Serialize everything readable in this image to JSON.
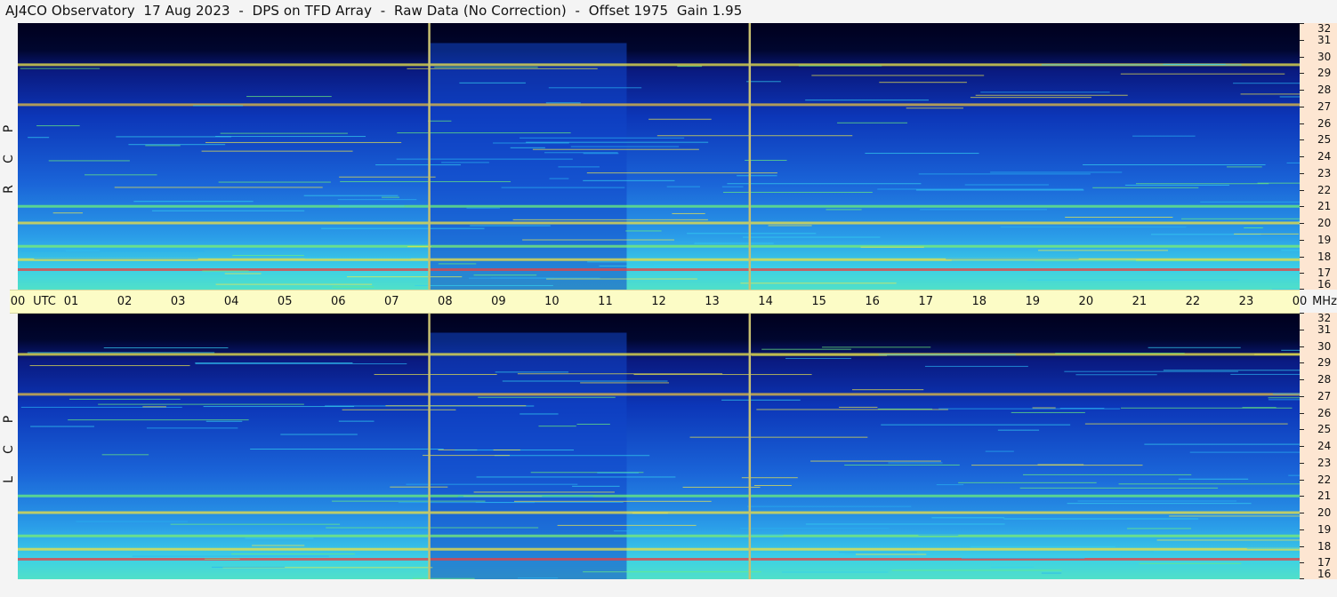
{
  "title": "AJ4CO Observatory  17 Aug 2023  -  DPS on TFD Array  -  Raw Data (No Correction)  -  Offset 1975  Gain 1.95",
  "panels": {
    "top_label_letters": [
      "R",
      "C",
      "P"
    ],
    "bottom_label_letters": [
      "L",
      "C",
      "P"
    ]
  },
  "time_axis": {
    "labels": [
      "00",
      "01",
      "02",
      "03",
      "04",
      "05",
      "06",
      "07",
      "08",
      "09",
      "10",
      "11",
      "12",
      "13",
      "14",
      "15",
      "16",
      "17",
      "18",
      "19",
      "20",
      "21",
      "22",
      "23",
      "00"
    ],
    "utc_label": "UTC",
    "mhz_label": "MHz"
  },
  "colors": {
    "background_dark": "#00002a",
    "deep_blue": "#0a2aa8",
    "mid_blue": "#1e6adf",
    "cyan": "#30c8f0",
    "green": "#6cf07a",
    "yellow": "#f0e84a",
    "red": "#e83a3a",
    "marker_line": "#c8c070",
    "time_band": "#fcfcc6",
    "freq_band": "#fde6d2"
  },
  "chart_data": {
    "type": "heatmap",
    "description_panels": [
      "RCP",
      "LCP"
    ],
    "x": {
      "label": "UTC",
      "range_hours": [
        0,
        24
      ],
      "ticks": [
        "00",
        "01",
        "02",
        "03",
        "04",
        "05",
        "06",
        "07",
        "08",
        "09",
        "10",
        "11",
        "12",
        "13",
        "14",
        "15",
        "16",
        "17",
        "18",
        "19",
        "20",
        "21",
        "22",
        "23",
        "00"
      ]
    },
    "y": {
      "label": "MHz",
      "range": [
        16,
        32
      ],
      "ticks": [
        16,
        17,
        18,
        19,
        20,
        21,
        22,
        23,
        24,
        25,
        26,
        27,
        28,
        29,
        30,
        31,
        32
      ]
    },
    "marker_times_utc": [
      7.7,
      13.7
    ],
    "strong_bands_mhz": [
      17.2,
      17.8,
      18.6,
      20.0,
      21.0,
      27.1,
      29.5
    ],
    "dark_region_mhz_above": 30.5
  }
}
